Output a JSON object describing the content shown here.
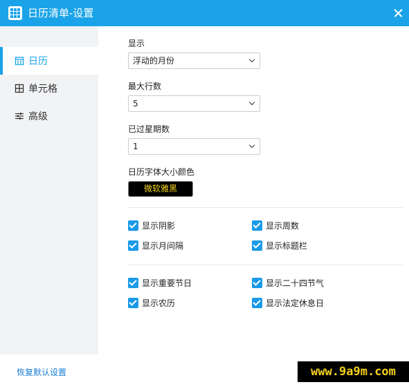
{
  "window": {
    "title": "日历清单-设置"
  },
  "sidebar": {
    "items": [
      {
        "label": "日历",
        "icon": "calendar-icon",
        "active": true
      },
      {
        "label": "单元格",
        "icon": "grid-icon",
        "active": false
      },
      {
        "label": "高级",
        "icon": "sliders-icon",
        "active": false
      }
    ]
  },
  "settings": {
    "display": {
      "label": "显示",
      "value": "浮动的月份"
    },
    "max_rows": {
      "label": "最大行数",
      "value": "5"
    },
    "past_weeks": {
      "label": "已过星期数",
      "value": "1"
    },
    "font": {
      "label": "日历字体大小颜色",
      "button": "微软雅黑"
    },
    "group1": [
      {
        "label": "显示阴影",
        "checked": true
      },
      {
        "label": "显示周数",
        "checked": true
      },
      {
        "label": "显示月间隔",
        "checked": true
      },
      {
        "label": "显示标题栏",
        "checked": true
      }
    ],
    "group2": [
      {
        "label": "显示重要节日",
        "checked": true
      },
      {
        "label": "显示二十四节气",
        "checked": true
      },
      {
        "label": "显示农历",
        "checked": true
      },
      {
        "label": "显示法定休息日",
        "checked": true
      }
    ]
  },
  "footer": {
    "reset": "恢复默认设置",
    "watermark": "www.9a9m.com"
  },
  "colors": {
    "accent": "#1aa3e8",
    "sidebar_bg": "#f2f3f5",
    "font_color": "#f5d21c"
  }
}
